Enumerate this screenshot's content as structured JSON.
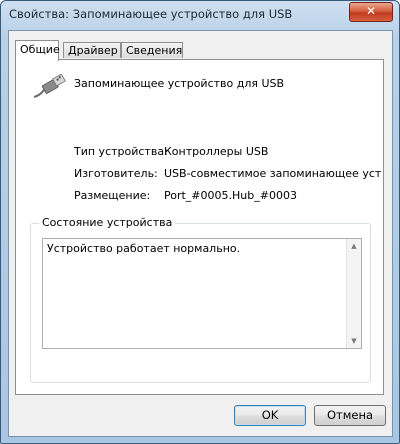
{
  "window": {
    "title": "Свойства: Запоминающее устройство для USB",
    "close_label": "✕"
  },
  "tabs": [
    {
      "label": "Общие",
      "active": true
    },
    {
      "label": "Драйвер",
      "active": false
    },
    {
      "label": "Сведения",
      "active": false
    }
  ],
  "device": {
    "icon": "usb-plug-icon",
    "name": "Запоминающее устройство для USB"
  },
  "properties": [
    {
      "label": "Тип устройства:",
      "value": "Контроллеры USB"
    },
    {
      "label": "Изготовитель:",
      "value": "USB-совместимое запоминающее устройство"
    },
    {
      "label": "Размещение:",
      "value": "Port_#0005.Hub_#0003"
    }
  ],
  "status": {
    "legend": "Состояние устройства",
    "text": "Устройство работает нормально."
  },
  "buttons": {
    "ok": "OK",
    "cancel": "Отмена"
  }
}
